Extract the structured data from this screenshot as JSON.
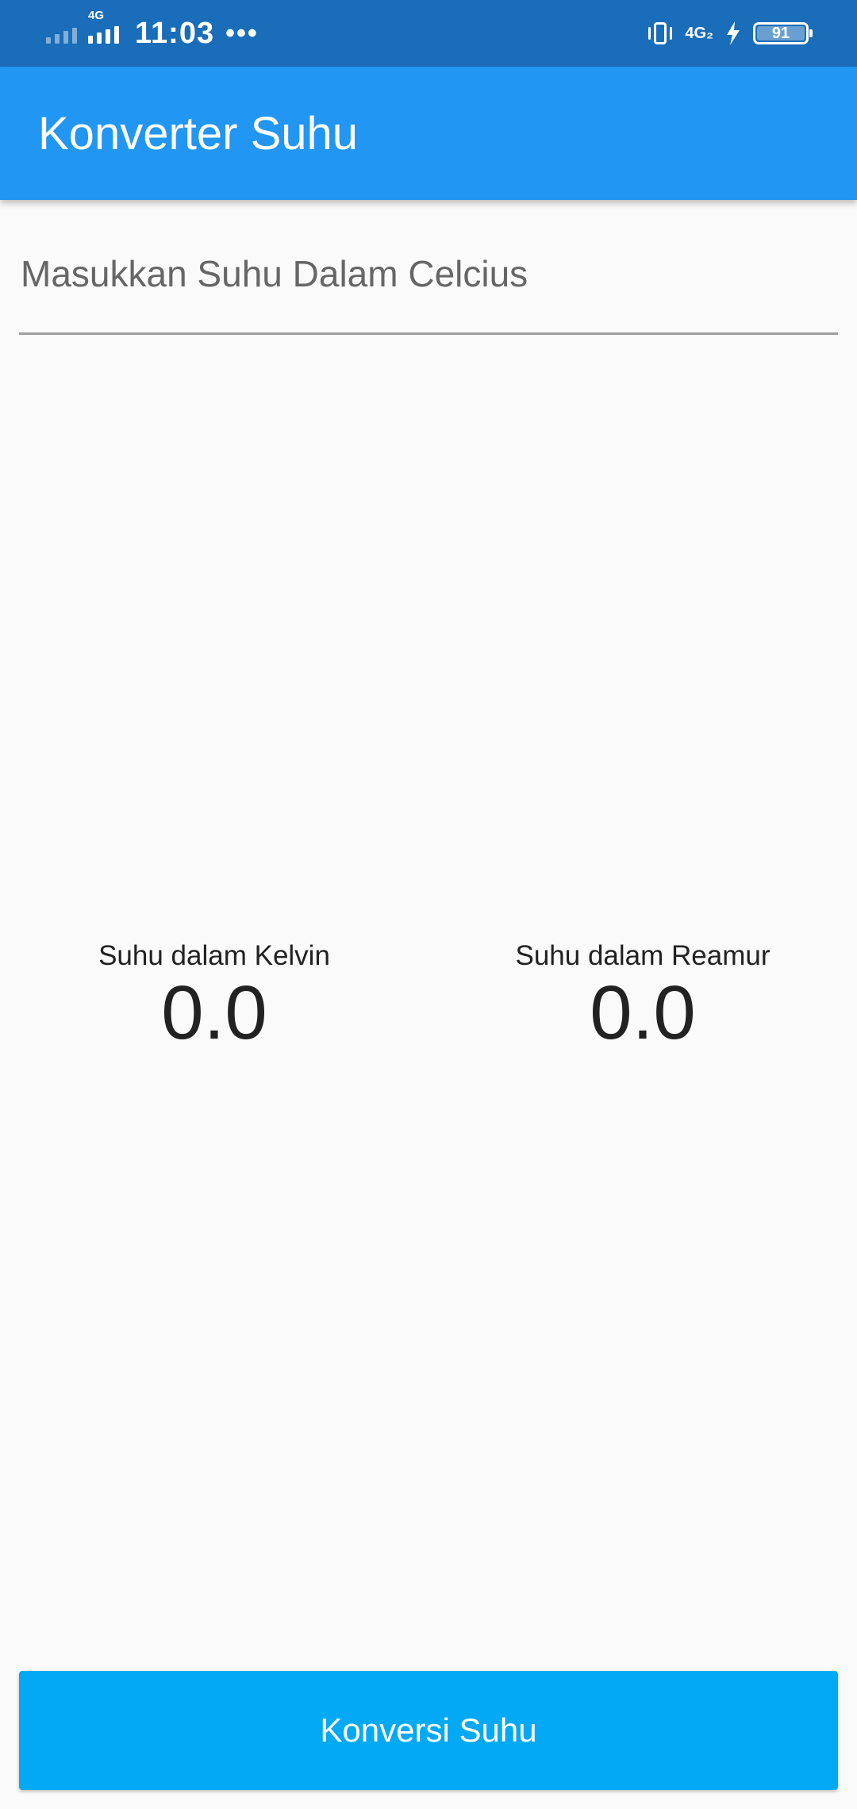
{
  "status_bar": {
    "network_left": "4G",
    "time": "11:03",
    "more_dots": "•••",
    "network_right": "4G₂",
    "battery_level": "91",
    "icons": [
      "signal-icon",
      "vibrate-icon",
      "charging-bolt-icon",
      "battery-icon"
    ]
  },
  "app_bar": {
    "title": "Konverter Suhu",
    "color": "#2196f3"
  },
  "input": {
    "placeholder": "Masukkan Suhu Dalam Celcius",
    "value": ""
  },
  "results": {
    "kelvin_label": "Suhu dalam Kelvin",
    "kelvin_value": "0.0",
    "reamur_label": "Suhu dalam Reamur",
    "reamur_value": "0.0"
  },
  "button": {
    "label": "Konversi Suhu",
    "color": "#03a9f4"
  }
}
